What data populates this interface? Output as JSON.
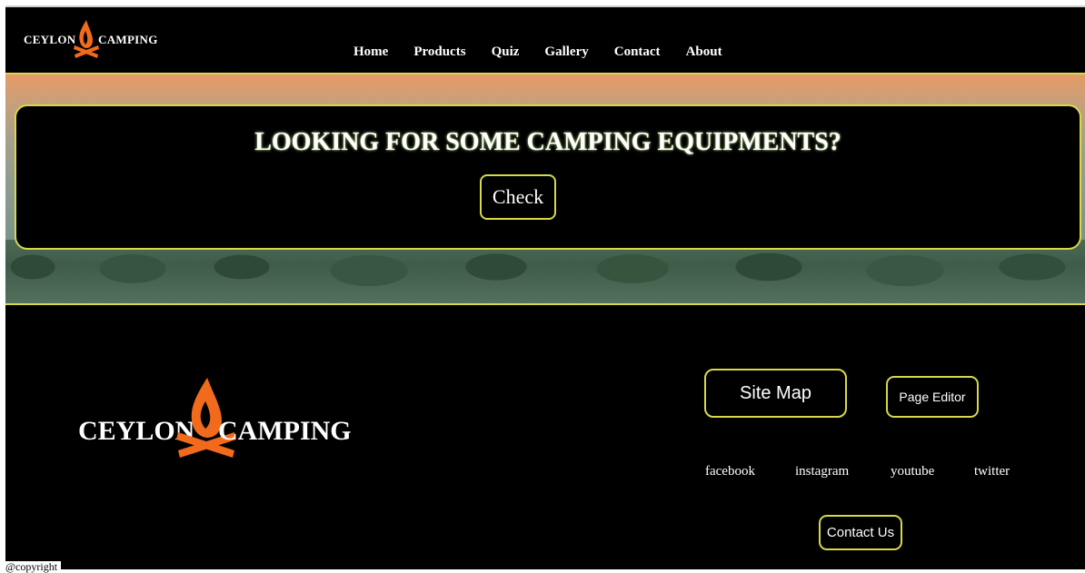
{
  "brand": {
    "word1": "CEYLON",
    "word2": "CAMPING",
    "accent_color": "#f26a1b",
    "border_color": "#d8d84a",
    "logo_icon": "campfire-icon"
  },
  "nav": {
    "items": [
      "Home",
      "Products",
      "Quiz",
      "Gallery",
      "Contact",
      "About"
    ]
  },
  "hero": {
    "title": "LOOKING FOR SOME CAMPING EQUIPMENTS?",
    "button": "Check"
  },
  "footer": {
    "sitemap": "Site Map",
    "page_editor": "Page Editor",
    "social": [
      "facebook",
      "instagram",
      "youtube",
      "twitter"
    ],
    "contact_us": "Contact Us",
    "copyright": "@copyright"
  }
}
